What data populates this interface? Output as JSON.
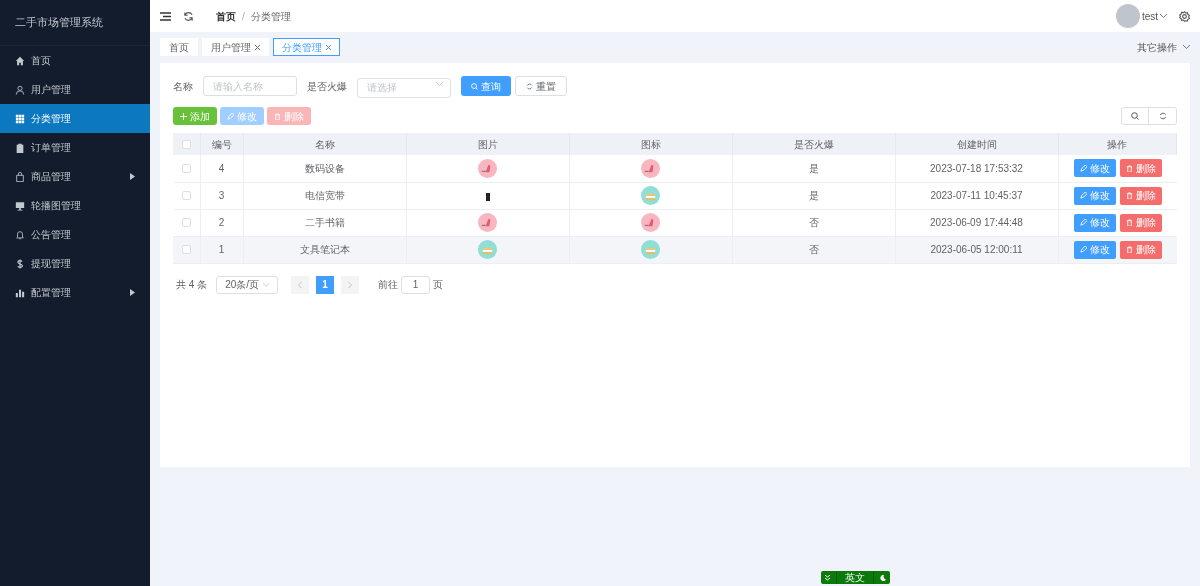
{
  "sidebar": {
    "title": "二手市场管理系统",
    "items": [
      {
        "label": "首页",
        "selected": false,
        "has_submenu": false
      },
      {
        "label": "用户管理",
        "selected": false,
        "has_submenu": false
      },
      {
        "label": "分类管理",
        "selected": true,
        "has_submenu": false
      },
      {
        "label": "订单管理",
        "selected": false,
        "has_submenu": false
      },
      {
        "label": "商品管理",
        "selected": false,
        "has_submenu": true
      },
      {
        "label": "轮播图管理",
        "selected": false,
        "has_submenu": false
      },
      {
        "label": "公告管理",
        "selected": false,
        "has_submenu": false
      },
      {
        "label": "提现管理",
        "selected": false,
        "has_submenu": false
      },
      {
        "label": "配置管理",
        "selected": false,
        "has_submenu": true
      }
    ]
  },
  "header": {
    "breadcrumb": [
      "首页",
      "分类管理"
    ],
    "breadcrumb_separator": "/",
    "user": "test"
  },
  "tabs": [
    {
      "label": "首页",
      "closable": false,
      "selected": false
    },
    {
      "label": "用户管理",
      "closable": true,
      "selected": false
    },
    {
      "label": "分类管理",
      "closable": true,
      "selected": true
    }
  ],
  "tabs_menu": "其它操作",
  "filters": [
    {
      "label": "名称",
      "kind": "input",
      "placeholder": "请输入名称"
    },
    {
      "label": "是否火爆",
      "kind": "select",
      "placeholder": "请选择"
    }
  ],
  "search_buttons": [
    {
      "label": "查询",
      "kind": "primary"
    },
    {
      "label": "重置",
      "kind": "plain"
    }
  ],
  "toolbar": [
    {
      "label": "添加",
      "kind": "add",
      "disabled": false
    },
    {
      "label": "修改",
      "kind": "edit",
      "disabled": true
    },
    {
      "label": "删除",
      "kind": "delete",
      "disabled": true
    }
  ],
  "table": {
    "select_all_checked": false,
    "columns": [
      "编号",
      "名称",
      "图片",
      "图标",
      "是否火爆",
      "创建时间",
      "操作"
    ],
    "rows": [
      {
        "id": "4",
        "name": "数码设备",
        "images": [
          {
            "kind": "pink"
          },
          {
            "kind": "pink"
          }
        ],
        "hot": "是",
        "created": "2023-07-18 17:53:32",
        "checked": false,
        "hovered": false,
        "actions": [
          "修改",
          "删除"
        ]
      },
      {
        "id": "3",
        "name": "电信宽带",
        "images": [
          {
            "kind": "broken"
          },
          {
            "kind": "teal"
          }
        ],
        "hot": "是",
        "created": "2023-07-11 10:45:37",
        "checked": false,
        "hovered": false,
        "actions": [
          "修改",
          "删除"
        ]
      },
      {
        "id": "2",
        "name": "二手书籍",
        "images": [
          {
            "kind": "pink"
          },
          {
            "kind": "pink"
          }
        ],
        "hot": "否",
        "created": "2023-06-09 17:44:48",
        "checked": false,
        "hovered": false,
        "actions": [
          "修改",
          "删除"
        ]
      },
      {
        "id": "1",
        "name": "文具笔记本",
        "images": [
          {
            "kind": "teal"
          },
          {
            "kind": "teal"
          }
        ],
        "hot": "否",
        "created": "2023-06-05 12:00:11",
        "checked": false,
        "hovered": true,
        "actions": [
          "修改",
          "删除"
        ]
      }
    ]
  },
  "pagination": {
    "total": "共 4 条",
    "page_size": "20条/页",
    "pages": [
      {
        "label": "1",
        "selected": true
      }
    ],
    "goto_label": "前往",
    "goto_value": "1",
    "goto_suffix": "页"
  },
  "ime_bar": {
    "label": "英文"
  }
}
